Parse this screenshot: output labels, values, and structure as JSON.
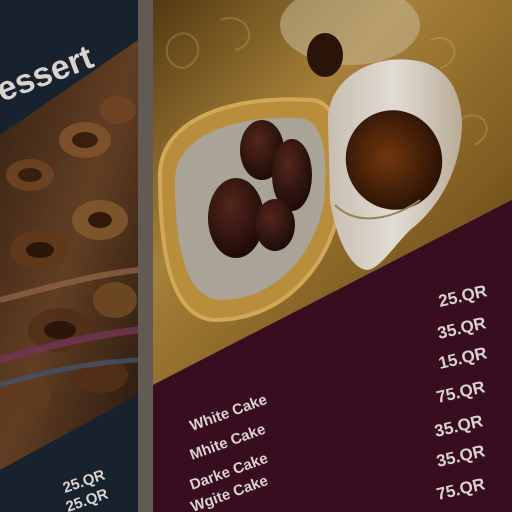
{
  "left_panel": {
    "title": "essert",
    "prices": [
      "25.QR",
      "25.QR"
    ]
  },
  "right_panel": {
    "items": [
      "White Cake",
      "Mhite Cake",
      "Darke Cake",
      "Wgite Cake"
    ],
    "prices": [
      "25.QR",
      "35.QR",
      "15.QR",
      "75.QR",
      "35.QR",
      "35.QR",
      "75.QR"
    ]
  },
  "colors": {
    "maroon": "#3d0f22",
    "navy": "#1b2533",
    "gold": "#b08a3c",
    "text": "#ece4df"
  }
}
